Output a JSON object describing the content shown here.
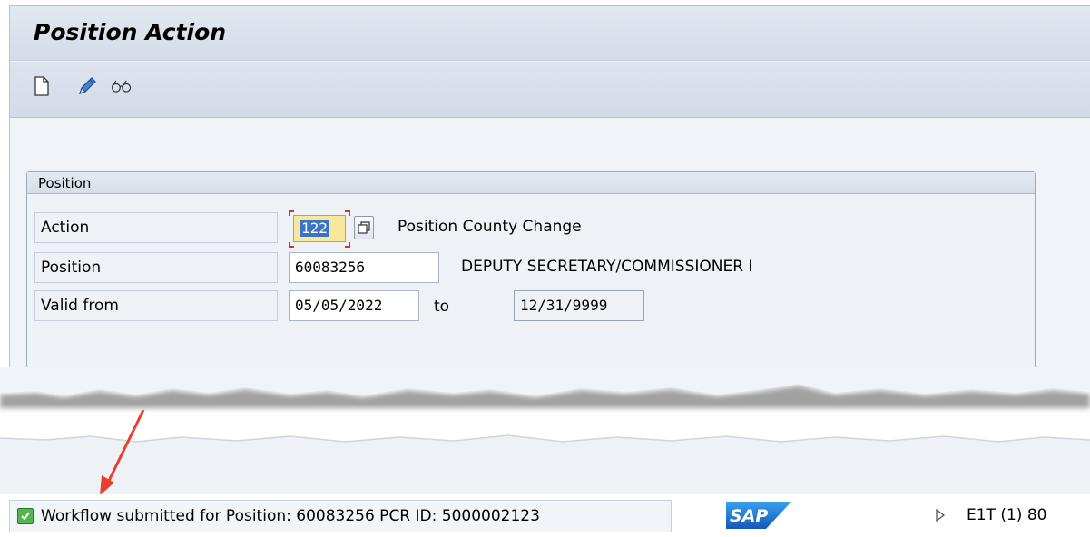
{
  "window": {
    "title": "Position Action"
  },
  "toolbar": {
    "icons": [
      "new-document-icon",
      "edit-pencil-icon",
      "display-glasses-icon"
    ]
  },
  "position_group": {
    "header": "Position",
    "action": {
      "label": "Action",
      "value": "122",
      "description": "Position County Change"
    },
    "position": {
      "label": "Position",
      "value": "60083256",
      "description": "DEPUTY SECRETARY/COMMISSIONER I"
    },
    "valid_from": {
      "label": "Valid from",
      "value": "05/05/2022",
      "to_label": "to",
      "to_value": "12/31/9999"
    }
  },
  "status": {
    "message": "Workflow submitted for Position: 60083256  PCR ID: 5000002123",
    "system_info": "E1T (1) 80",
    "logo_text": "SAP"
  },
  "colors": {
    "title_bar": "#d9e1ec",
    "field_highlight": "#f9e79b",
    "selection": "#3a73c8",
    "success_green": "#54b44e",
    "arrow_red": "#e8402f",
    "sap_blue": "#1c6fc8"
  }
}
